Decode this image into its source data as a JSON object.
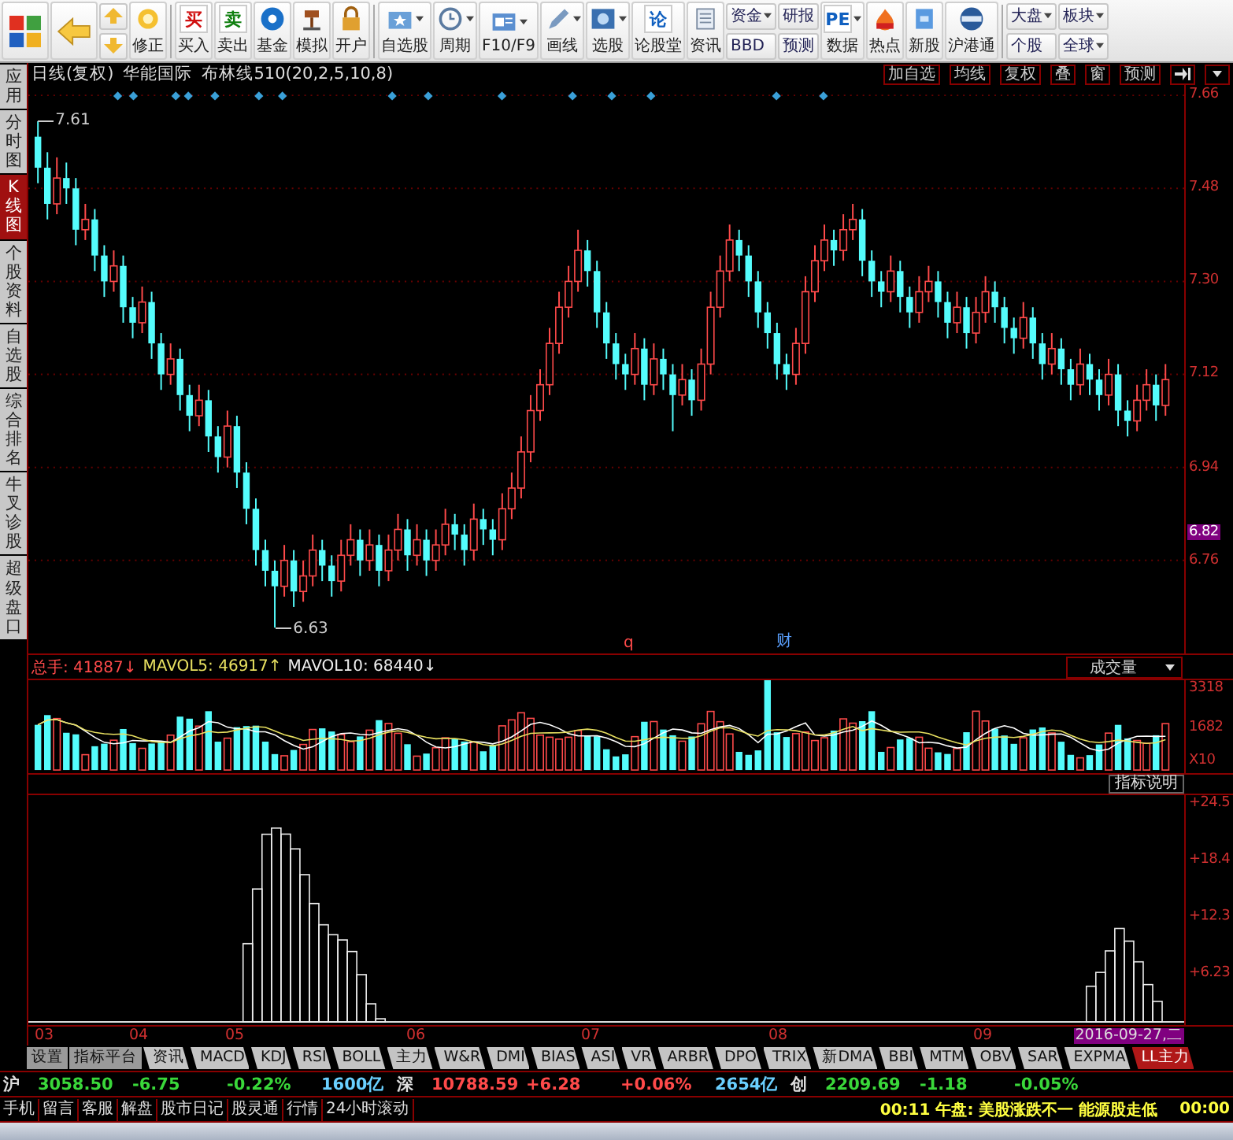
{
  "toolbar": [
    {
      "kind": "logo"
    },
    {
      "kind": "back"
    },
    {
      "kind": "arrows"
    },
    {
      "kind": "button",
      "label": "修正",
      "dropdown": false
    },
    {
      "kind": "divider"
    },
    {
      "kind": "button",
      "label": "买入",
      "glyph": "买",
      "dropdown": false
    },
    {
      "kind": "button",
      "label": "卖出",
      "glyph": "卖",
      "dropdown": false
    },
    {
      "kind": "button",
      "label": "基金",
      "dropdown": false
    },
    {
      "kind": "button",
      "label": "模拟",
      "dropdown": false
    },
    {
      "kind": "button",
      "label": "开户",
      "dropdown": false
    },
    {
      "kind": "divider"
    },
    {
      "kind": "button",
      "label": "自选股",
      "dropdown": true
    },
    {
      "kind": "button",
      "label": "周期",
      "dropdown": true
    },
    {
      "kind": "button",
      "label": "F10/F9",
      "dropdown": true
    },
    {
      "kind": "button",
      "label": "画线",
      "dropdown": true
    },
    {
      "kind": "button",
      "label": "选股",
      "dropdown": true
    },
    {
      "kind": "button",
      "label": "论股堂",
      "glyph": "论",
      "dropdown": false
    },
    {
      "kind": "button",
      "label": "资讯",
      "dropdown": false
    },
    {
      "kind": "stacked",
      "items": [
        {
          "label": "资金",
          "dropdown": true
        },
        {
          "label": "BBD",
          "dropdown": false
        }
      ]
    },
    {
      "kind": "stacked",
      "items": [
        {
          "label": "研报",
          "dropdown": false
        },
        {
          "label": "预测",
          "dropdown": false
        }
      ]
    },
    {
      "kind": "button",
      "label": "数据",
      "glyph": "PE",
      "dropdown": true
    },
    {
      "kind": "button",
      "label": "热点",
      "dropdown": false
    },
    {
      "kind": "button",
      "label": "新股",
      "dropdown": false
    },
    {
      "kind": "button",
      "label": "沪港通",
      "dropdown": false
    },
    {
      "kind": "divider"
    },
    {
      "kind": "stacked",
      "items": [
        {
          "label": "大盘",
          "dropdown": true
        },
        {
          "label": "个股",
          "dropdown": false
        }
      ]
    },
    {
      "kind": "stacked",
      "items": [
        {
          "label": "板块",
          "dropdown": true
        },
        {
          "label": "全球",
          "dropdown": true
        }
      ]
    }
  ],
  "sidebar": [
    {
      "label": "应用",
      "selected": false
    },
    {
      "label": "分时图",
      "selected": false
    },
    {
      "label": "K线图",
      "selected": true
    },
    {
      "label": "个股资料",
      "selected": false
    },
    {
      "label": "自选股",
      "selected": false
    },
    {
      "label": "综合排名",
      "selected": false
    },
    {
      "label": "牛叉诊股",
      "selected": false
    },
    {
      "label": "超级盘口",
      "selected": false
    }
  ],
  "header": {
    "period": "日线(复权)",
    "stock": "华能国际",
    "indicator": "布林线510(20,2,5,10,8)",
    "buttons": [
      "加自选",
      "均线",
      "复权",
      "叠",
      "窗",
      "预测"
    ]
  },
  "price_chart": {
    "current_price": "6.82",
    "high_label": "7.61",
    "low_label": "6.63",
    "markers": [
      "q",
      "财"
    ],
    "chart_data": {
      "type": "candlestick",
      "grid": true,
      "ylim": [
        6.58,
        7.68
      ],
      "yticks": [
        {
          "value": 7.66,
          "label": "7.66"
        },
        {
          "value": 7.48,
          "label": "7.48"
        },
        {
          "value": 7.3,
          "label": "7.30"
        },
        {
          "value": 7.12,
          "label": "7.12"
        },
        {
          "value": 6.94,
          "label": "6.94"
        },
        {
          "value": 6.76,
          "label": "6.76"
        }
      ],
      "ohlc": [
        [
          7.58,
          7.61,
          7.49,
          7.52
        ],
        [
          7.52,
          7.55,
          7.42,
          7.45
        ],
        [
          7.45,
          7.54,
          7.43,
          7.5
        ],
        [
          7.5,
          7.53,
          7.45,
          7.48
        ],
        [
          7.48,
          7.5,
          7.37,
          7.4
        ],
        [
          7.4,
          7.45,
          7.38,
          7.42
        ],
        [
          7.42,
          7.44,
          7.32,
          7.35
        ],
        [
          7.35,
          7.37,
          7.27,
          7.3
        ],
        [
          7.3,
          7.36,
          7.28,
          7.33
        ],
        [
          7.33,
          7.35,
          7.22,
          7.25
        ],
        [
          7.25,
          7.27,
          7.19,
          7.22
        ],
        [
          7.22,
          7.29,
          7.2,
          7.26
        ],
        [
          7.26,
          7.28,
          7.15,
          7.18
        ],
        [
          7.18,
          7.2,
          7.09,
          7.12
        ],
        [
          7.12,
          7.18,
          7.1,
          7.15
        ],
        [
          7.15,
          7.17,
          7.05,
          7.08
        ],
        [
          7.08,
          7.1,
          7.01,
          7.04
        ],
        [
          7.04,
          7.1,
          7.02,
          7.07
        ],
        [
          7.07,
          7.09,
          6.97,
          7.0
        ],
        [
          7.0,
          7.02,
          6.93,
          6.96
        ],
        [
          6.96,
          7.05,
          6.94,
          7.02
        ],
        [
          7.02,
          7.04,
          6.9,
          6.93
        ],
        [
          6.93,
          6.95,
          6.83,
          6.86
        ],
        [
          6.86,
          6.88,
          6.75,
          6.78
        ],
        [
          6.78,
          6.8,
          6.71,
          6.74
        ],
        [
          6.74,
          6.76,
          6.63,
          6.71
        ],
        [
          6.71,
          6.79,
          6.69,
          6.76
        ],
        [
          6.76,
          6.78,
          6.67,
          6.7
        ],
        [
          6.7,
          6.76,
          6.68,
          6.73
        ],
        [
          6.73,
          6.81,
          6.71,
          6.78
        ],
        [
          6.78,
          6.8,
          6.72,
          6.75
        ],
        [
          6.75,
          6.77,
          6.69,
          6.72
        ],
        [
          6.72,
          6.8,
          6.7,
          6.77
        ],
        [
          6.77,
          6.83,
          6.75,
          6.8
        ],
        [
          6.8,
          6.82,
          6.73,
          6.76
        ],
        [
          6.76,
          6.82,
          6.74,
          6.79
        ],
        [
          6.79,
          6.81,
          6.71,
          6.74
        ],
        [
          6.74,
          6.81,
          6.72,
          6.78
        ],
        [
          6.78,
          6.85,
          6.76,
          6.82
        ],
        [
          6.82,
          6.84,
          6.74,
          6.77
        ],
        [
          6.77,
          6.83,
          6.75,
          6.8
        ],
        [
          6.8,
          6.82,
          6.73,
          6.76
        ],
        [
          6.76,
          6.82,
          6.74,
          6.79
        ],
        [
          6.79,
          6.86,
          6.77,
          6.83
        ],
        [
          6.83,
          6.85,
          6.78,
          6.81
        ],
        [
          6.81,
          6.83,
          6.75,
          6.78
        ],
        [
          6.78,
          6.87,
          6.76,
          6.84
        ],
        [
          6.84,
          6.86,
          6.79,
          6.82
        ],
        [
          6.82,
          6.84,
          6.77,
          6.8
        ],
        [
          6.8,
          6.89,
          6.78,
          6.86
        ],
        [
          6.86,
          6.93,
          6.84,
          6.9
        ],
        [
          6.9,
          7.0,
          6.88,
          6.97
        ],
        [
          6.97,
          7.08,
          6.95,
          7.05
        ],
        [
          7.05,
          7.13,
          7.03,
          7.1
        ],
        [
          7.1,
          7.21,
          7.08,
          7.18
        ],
        [
          7.18,
          7.28,
          7.16,
          7.25
        ],
        [
          7.25,
          7.33,
          7.23,
          7.3
        ],
        [
          7.3,
          7.4,
          7.28,
          7.36
        ],
        [
          7.36,
          7.38,
          7.29,
          7.32
        ],
        [
          7.32,
          7.34,
          7.21,
          7.24
        ],
        [
          7.24,
          7.26,
          7.15,
          7.18
        ],
        [
          7.18,
          7.2,
          7.11,
          7.14
        ],
        [
          7.14,
          7.16,
          7.09,
          7.12
        ],
        [
          7.12,
          7.2,
          7.1,
          7.17
        ],
        [
          7.17,
          7.19,
          7.07,
          7.1
        ],
        [
          7.1,
          7.18,
          7.08,
          7.15
        ],
        [
          7.15,
          7.17,
          7.09,
          7.12
        ],
        [
          7.12,
          7.14,
          7.01,
          7.08
        ],
        [
          7.08,
          7.14,
          7.06,
          7.11
        ],
        [
          7.11,
          7.13,
          7.04,
          7.07
        ],
        [
          7.07,
          7.17,
          7.05,
          7.14
        ],
        [
          7.14,
          7.28,
          7.12,
          7.25
        ],
        [
          7.25,
          7.35,
          7.23,
          7.32
        ],
        [
          7.32,
          7.41,
          7.3,
          7.38
        ],
        [
          7.38,
          7.4,
          7.32,
          7.35
        ],
        [
          7.35,
          7.37,
          7.27,
          7.3
        ],
        [
          7.3,
          7.32,
          7.21,
          7.24
        ],
        [
          7.24,
          7.26,
          7.17,
          7.2
        ],
        [
          7.2,
          7.22,
          7.11,
          7.14
        ],
        [
          7.14,
          7.16,
          7.09,
          7.12
        ],
        [
          7.12,
          7.21,
          7.1,
          7.18
        ],
        [
          7.18,
          7.31,
          7.16,
          7.28
        ],
        [
          7.28,
          7.37,
          7.26,
          7.34
        ],
        [
          7.34,
          7.41,
          7.32,
          7.38
        ],
        [
          7.38,
          7.4,
          7.33,
          7.36
        ],
        [
          7.36,
          7.43,
          7.34,
          7.4
        ],
        [
          7.4,
          7.45,
          7.38,
          7.42
        ],
        [
          7.42,
          7.44,
          7.31,
          7.34
        ],
        [
          7.34,
          7.36,
          7.27,
          7.3
        ],
        [
          7.3,
          7.32,
          7.25,
          7.28
        ],
        [
          7.28,
          7.35,
          7.26,
          7.32
        ],
        [
          7.32,
          7.34,
          7.24,
          7.27
        ],
        [
          7.27,
          7.29,
          7.21,
          7.24
        ],
        [
          7.24,
          7.31,
          7.22,
          7.28
        ],
        [
          7.28,
          7.33,
          7.26,
          7.3
        ],
        [
          7.3,
          7.32,
          7.23,
          7.26
        ],
        [
          7.26,
          7.28,
          7.19,
          7.22
        ],
        [
          7.22,
          7.28,
          7.2,
          7.25
        ],
        [
          7.25,
          7.27,
          7.17,
          7.2
        ],
        [
          7.2,
          7.27,
          7.18,
          7.24
        ],
        [
          7.24,
          7.31,
          7.22,
          7.28
        ],
        [
          7.28,
          7.3,
          7.22,
          7.25
        ],
        [
          7.25,
          7.27,
          7.18,
          7.21
        ],
        [
          7.21,
          7.23,
          7.16,
          7.19
        ],
        [
          7.19,
          7.26,
          7.17,
          7.23
        ],
        [
          7.23,
          7.25,
          7.15,
          7.18
        ],
        [
          7.18,
          7.2,
          7.11,
          7.14
        ],
        [
          7.14,
          7.2,
          7.12,
          7.17
        ],
        [
          7.17,
          7.19,
          7.1,
          7.13
        ],
        [
          7.13,
          7.15,
          7.07,
          7.1
        ],
        [
          7.1,
          7.17,
          7.08,
          7.14
        ],
        [
          7.14,
          7.16,
          7.08,
          7.11
        ],
        [
          7.11,
          7.13,
          7.05,
          7.08
        ],
        [
          7.08,
          7.15,
          7.06,
          7.12
        ],
        [
          7.12,
          7.14,
          7.02,
          7.05
        ],
        [
          7.05,
          7.07,
          7.0,
          7.03
        ],
        [
          7.03,
          7.1,
          7.01,
          7.07
        ],
        [
          7.07,
          7.13,
          7.05,
          7.1
        ],
        [
          7.1,
          7.12,
          7.03,
          7.06
        ],
        [
          7.06,
          7.14,
          7.04,
          7.11
        ]
      ]
    }
  },
  "volume": {
    "readings": [
      {
        "kind": "total",
        "text": "总手: 41887↓"
      },
      {
        "kind": "ma5",
        "text": "MAVOL5: 46917↑"
      },
      {
        "kind": "ma10",
        "text": "MAVOL10: 68440↓"
      }
    ],
    "selector": "成交量",
    "axis": [
      "3318",
      "1682",
      "X10"
    ],
    "help_button": "指标说明"
  },
  "lower_chart": {
    "axis": [
      "+24.5",
      "+18.4",
      "+12.3",
      "+6.23"
    ]
  },
  "months": [
    "03",
    "04",
    "05",
    "06",
    "07",
    "08",
    "09"
  ],
  "date_label": "2016-09-27,二",
  "indicator_tabs": [
    {
      "label": "设置",
      "kind": "plain",
      "selected": false
    },
    {
      "label": "指标平台",
      "kind": "plain",
      "selected": false
    },
    {
      "label": "资讯",
      "kind": "tab",
      "selected": false
    },
    {
      "label": "MACD",
      "kind": "tab",
      "selected": false
    },
    {
      "label": "KDJ",
      "kind": "tab",
      "selected": false
    },
    {
      "label": "RSI",
      "kind": "tab",
      "selected": false
    },
    {
      "label": "BOLL",
      "kind": "tab",
      "selected": false
    },
    {
      "label": "主力",
      "kind": "tab",
      "selected": false
    },
    {
      "label": "W&R",
      "kind": "tab",
      "selected": false
    },
    {
      "label": "DMI",
      "kind": "tab",
      "selected": false
    },
    {
      "label": "BIAS",
      "kind": "tab",
      "selected": false
    },
    {
      "label": "ASI",
      "kind": "tab",
      "selected": false
    },
    {
      "label": "VR",
      "kind": "tab",
      "selected": false
    },
    {
      "label": "ARBR",
      "kind": "tab",
      "selected": false
    },
    {
      "label": "DPO",
      "kind": "tab",
      "selected": false
    },
    {
      "label": "TRIX",
      "kind": "tab",
      "selected": false
    },
    {
      "label": "新DMA",
      "kind": "tab",
      "selected": false
    },
    {
      "label": "BBI",
      "kind": "tab",
      "selected": false
    },
    {
      "label": "MTM",
      "kind": "tab",
      "selected": false
    },
    {
      "label": "OBV",
      "kind": "tab",
      "selected": false
    },
    {
      "label": "SAR",
      "kind": "tab",
      "selected": false
    },
    {
      "label": "EXPMA",
      "kind": "tab",
      "selected": false
    },
    {
      "label": "LL主力",
      "kind": "tab",
      "selected": true
    }
  ],
  "quotes": [
    {
      "kind": "label",
      "text": "沪"
    },
    {
      "kind": "down",
      "text": "3058.50"
    },
    {
      "kind": "down",
      "text": "-6.75"
    },
    {
      "kind": "down",
      "text": "-0.22%"
    },
    {
      "kind": "amount",
      "text": "1600亿"
    },
    {
      "kind": "label",
      "text": "深"
    },
    {
      "kind": "up",
      "text": "10788.59"
    },
    {
      "kind": "up",
      "text": "+6.28"
    },
    {
      "kind": "up",
      "text": "+0.06%"
    },
    {
      "kind": "amount",
      "text": "2654亿"
    },
    {
      "kind": "label",
      "text": "创"
    },
    {
      "kind": "down",
      "text": "2209.69"
    },
    {
      "kind": "down",
      "text": "-1.18"
    },
    {
      "kind": "down",
      "text": "-0.05%"
    }
  ],
  "status_links": [
    "手机",
    "留言",
    "客服",
    "解盘",
    "股市日记",
    "股灵通",
    "行情",
    "24小时滚动"
  ],
  "news": [
    "00:11 午盘: 美股涨跌不一 能源股走低",
    "00:00"
  ]
}
